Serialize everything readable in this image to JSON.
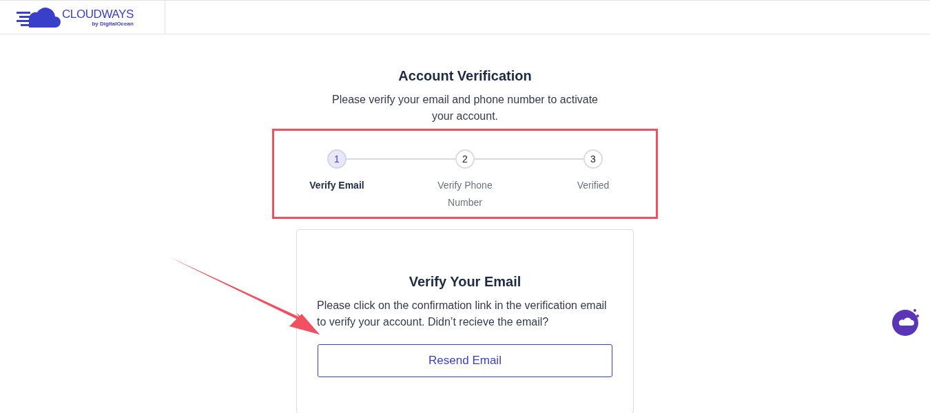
{
  "logo": {
    "name": "CLOUDWAYS",
    "tagline": "by DigitalOcean"
  },
  "heading": "Account Verification",
  "subheading": "Please verify your email and phone number to activate your account.",
  "steps": [
    {
      "number": "1",
      "label": "Verify Email",
      "selected": true
    },
    {
      "number": "2",
      "label": "Verify Phone Number",
      "selected": false
    },
    {
      "number": "3",
      "label": "Verified",
      "selected": false
    }
  ],
  "card": {
    "title": "Verify Your Email",
    "message": "Please click on the confirmation link in the verification email to verify your account. Didn’t recieve the email?",
    "button": "Resend Email"
  }
}
